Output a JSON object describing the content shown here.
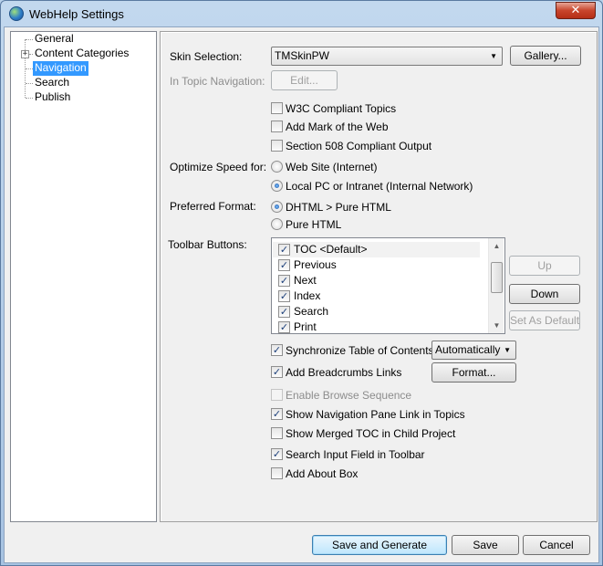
{
  "window": {
    "title": "WebHelp Settings",
    "close_glyph": "✕"
  },
  "tree": {
    "expander_glyph": "+",
    "items": [
      {
        "label": "General"
      },
      {
        "label": "Content Categories"
      },
      {
        "label": "Navigation"
      },
      {
        "label": "Search"
      },
      {
        "label": "Publish"
      }
    ],
    "selected": "Navigation"
  },
  "skin": {
    "label": "Skin Selection:",
    "value": "TMSkinPW",
    "gallery_button": "Gallery..."
  },
  "in_topic": {
    "label": "In Topic Navigation:",
    "edit_button": "Edit..."
  },
  "checks_top": [
    {
      "label": "W3C Compliant Topics",
      "checked": false
    },
    {
      "label": "Add Mark of the Web",
      "checked": false
    },
    {
      "label": "Section 508 Compliant Output",
      "checked": false
    }
  ],
  "optimize": {
    "label": "Optimize Speed for:",
    "options": [
      "Web Site (Internet)",
      "Local PC or Intranet (Internal Network)"
    ],
    "selected_index": 1
  },
  "format": {
    "label": "Preferred Format:",
    "options": [
      "DHTML > Pure HTML",
      "Pure HTML"
    ],
    "selected_index": 0
  },
  "toolbar": {
    "label": "Toolbar Buttons:",
    "items": [
      {
        "label": "TOC <Default>",
        "checked": true
      },
      {
        "label": "Previous",
        "checked": true
      },
      {
        "label": "Next",
        "checked": true
      },
      {
        "label": "Index",
        "checked": true
      },
      {
        "label": "Search",
        "checked": true
      },
      {
        "label": "Print",
        "checked": true
      }
    ],
    "up_button": "Up",
    "down_button": "Down",
    "set_default_button": "Set As Default",
    "scroll_up_glyph": "▲",
    "scroll_down_glyph": "▼"
  },
  "sync_toc": {
    "label": "Synchronize Table of Contents",
    "checked": true,
    "mode": "Automatically"
  },
  "breadcrumbs": {
    "label": "Add Breadcrumbs Links",
    "checked": true,
    "format_button": "Format..."
  },
  "checks_bottom": [
    {
      "label": "Enable Browse Sequence",
      "checked": false,
      "disabled": true
    },
    {
      "label": "Show Navigation Pane Link in Topics",
      "checked": true
    },
    {
      "label": "Show Merged TOC in Child Project",
      "checked": false
    },
    {
      "label": "Search Input Field in Toolbar",
      "checked": true
    },
    {
      "label": "Add About Box",
      "checked": false
    }
  ],
  "footer": {
    "generate_button": "Save and Generate",
    "save_button": "Save",
    "cancel_button": "Cancel"
  },
  "glyphs": {
    "check": "✓",
    "dropdown": "▼"
  },
  "colors": {
    "selection": "#3399ff",
    "check": "#1c3f7a",
    "close": "#c8452c"
  }
}
